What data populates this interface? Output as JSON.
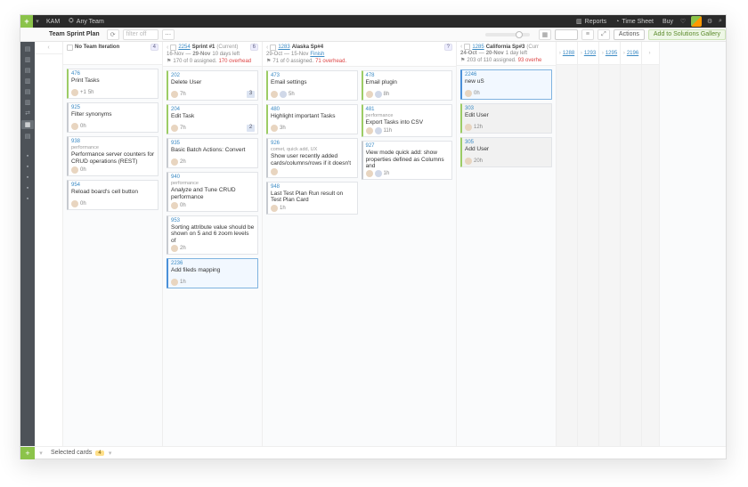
{
  "topbar": {
    "workspace": "KAM",
    "team": "Any Team",
    "reports": "Reports",
    "timesheet": "Time Sheet",
    "buy": "Buy"
  },
  "toolbar": {
    "title": "Team Sprint Plan",
    "filter_placeholder": "filter off",
    "actions": "Actions",
    "add_gallery": "Add to Solutions Gallery"
  },
  "lanes": {
    "no_team": {
      "name": "No Team Iteration",
      "count": "4"
    },
    "sprint1": {
      "id": "2254",
      "name": "Sprint #1",
      "current": "(Current)",
      "count": "6",
      "dates_a": "16-Nov",
      "dates_b": "29-Nov",
      "days": "10 days left",
      "assign": "170 of 0 assigned.",
      "overhead": "170 overhead",
      "cards": [
        {
          "id": "202",
          "title": "Delete User",
          "effort": "7h",
          "pill": "3"
        },
        {
          "id": "204",
          "title": "Edit Task",
          "effort": "7h",
          "pill": "2"
        },
        {
          "id": "935",
          "title": "Basic Batch Actions: Convert",
          "effort": "2h"
        },
        {
          "id": "940",
          "tags": "performance",
          "title": "Analyze and Tune CRUD performance",
          "effort": "0h"
        },
        {
          "id": "953",
          "title": "Sorting attribute value should be shown on 5 and 6 zoom levels of",
          "effort": "2h"
        },
        {
          "id": "2236",
          "title": "Add fileds mapping",
          "effort": "1h"
        }
      ]
    },
    "alaska": {
      "id": "1283",
      "name": "Alaska Sp#4",
      "count": "?",
      "dates_a": "29-Oct",
      "dates_b": "15-Nov",
      "finish": "Finish",
      "assign": "71 of 0 assigned.",
      "overhead": "71 overhead.",
      "colA": [
        {
          "id": "473",
          "title": "Email settings",
          "effort": "5h"
        },
        {
          "id": "480",
          "title": "Highlight important Tasks",
          "effort": "3h"
        },
        {
          "id": "926",
          "tags": "comet, quick add, UX",
          "title": "Show user recently added cards/columns/rows if it doesn't"
        },
        {
          "id": "948",
          "title": "Last Test Plan Run result on Test Plan Card",
          "effort": "1h"
        }
      ],
      "colB": [
        {
          "id": "478",
          "title": "Email plugin",
          "effort": "8h"
        },
        {
          "id": "481",
          "tags": "performance",
          "title": "Export Tasks into CSV",
          "effort": "11h"
        },
        {
          "id": "927",
          "title": "View mode quick add: show properties defined as Columns and",
          "effort": "1h"
        }
      ]
    },
    "california": {
      "id": "1285",
      "name": "California Sp#3",
      "current": "(Curr",
      "dates_a": "24-Oct",
      "dates_b": "20-Nov",
      "days": "1 day left",
      "assign": "203 of 110 assigned.",
      "overhead": "93 overhe",
      "cards": [
        {
          "id": "2246",
          "title": "new uS",
          "effort": "0h"
        },
        {
          "id": "303",
          "title": "Edit User",
          "effort": "12h"
        },
        {
          "id": "305",
          "title": "Add User",
          "effort": "20h"
        }
      ]
    },
    "no_team_cards": [
      {
        "id": "476",
        "title": "Print Tasks",
        "effort": "5h",
        "extra": "+1"
      },
      {
        "id": "925",
        "title": "Filter synonyms",
        "effort": "0h"
      },
      {
        "id": "938",
        "tags": "performance",
        "title": "Performance server counters for CRUD operations (REST)",
        "effort": "0h"
      },
      {
        "id": "954",
        "title": "Reload board's cell button",
        "effort": "0h"
      }
    ],
    "hidden": [
      "1288",
      "1293",
      "1295",
      "2196"
    ]
  },
  "footer": {
    "label": "Selected cards",
    "count": "4"
  }
}
